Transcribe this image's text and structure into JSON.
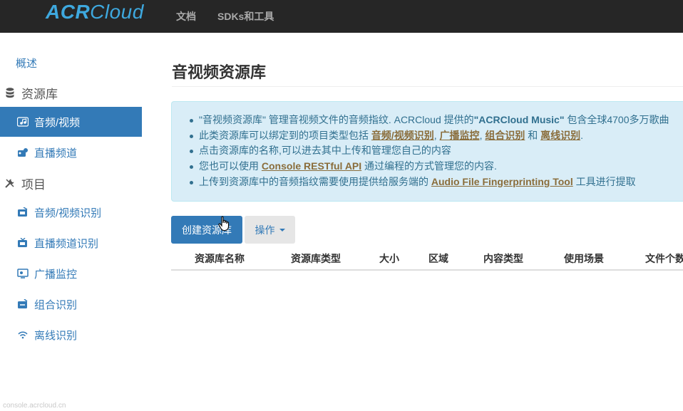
{
  "navbar": {
    "brand_bold": "ACR",
    "brand_light": "Cloud",
    "links": [
      "文档",
      "SDKs和工具"
    ]
  },
  "sidebar": {
    "overview": "概述",
    "library_header": "资源库",
    "library_items": [
      "音频/视频",
      "直播频道"
    ],
    "project_header": "项目",
    "project_items": [
      "音频/视频识别",
      "直播频道识别",
      "广播监控",
      "组合识别",
      "离线识别"
    ],
    "active_item": "音频/视频"
  },
  "status_url": "console.acrcloud.cn",
  "main": {
    "title": "音视频资源库",
    "info": {
      "line1_pre": "\"音视频资源库\" 管理音视频文件的音频指纹. ACRCloud 提供的",
      "line1_bold": "\"ACRCloud Music\"",
      "line1_post": " 包含全球4700多万歌曲",
      "line2_pre": "此类资源库可以绑定到的项目类型包括 ",
      "line2_links": [
        "音频/视频识别",
        "广播监控",
        "组合识别",
        "离线识别"
      ],
      "line2_sep1": ", ",
      "line2_sep2": ", ",
      "line2_sep3": " 和 ",
      "line2_end": ".",
      "line3": "点击资源库的名称,可以进去其中上传和管理您自己的内容",
      "line4_pre": "您也可以使用 ",
      "line4_link": "Console RESTful API",
      "line4_post": " 通过编程的方式管理您的内容.",
      "line5_pre": "上传到资源库中的音频指纹需要使用提供给服务端的 ",
      "line5_link": "Audio File Fingerprinting Tool",
      "line5_post": " 工具进行提取"
    },
    "create_button": "创建资源库",
    "action_button": "操作",
    "table_headers": [
      "资源库名称",
      "资源库类型",
      "大小",
      "区域",
      "内容类型",
      "使用场景",
      "文件个数"
    ]
  },
  "colors": {
    "navbar_bg": "#262626",
    "brand": "#3ea8de",
    "primary": "#337ab7",
    "info_bg": "#d9edf7",
    "info_text": "#31708f",
    "info_link": "#8a6d3b"
  },
  "icons": {
    "library_header": "database-icon",
    "project_header": "wrench-icon",
    "audio_video": "music-box-icon",
    "live_channel": "broadcast-icon",
    "cursor": "hand-pointer-icon"
  }
}
